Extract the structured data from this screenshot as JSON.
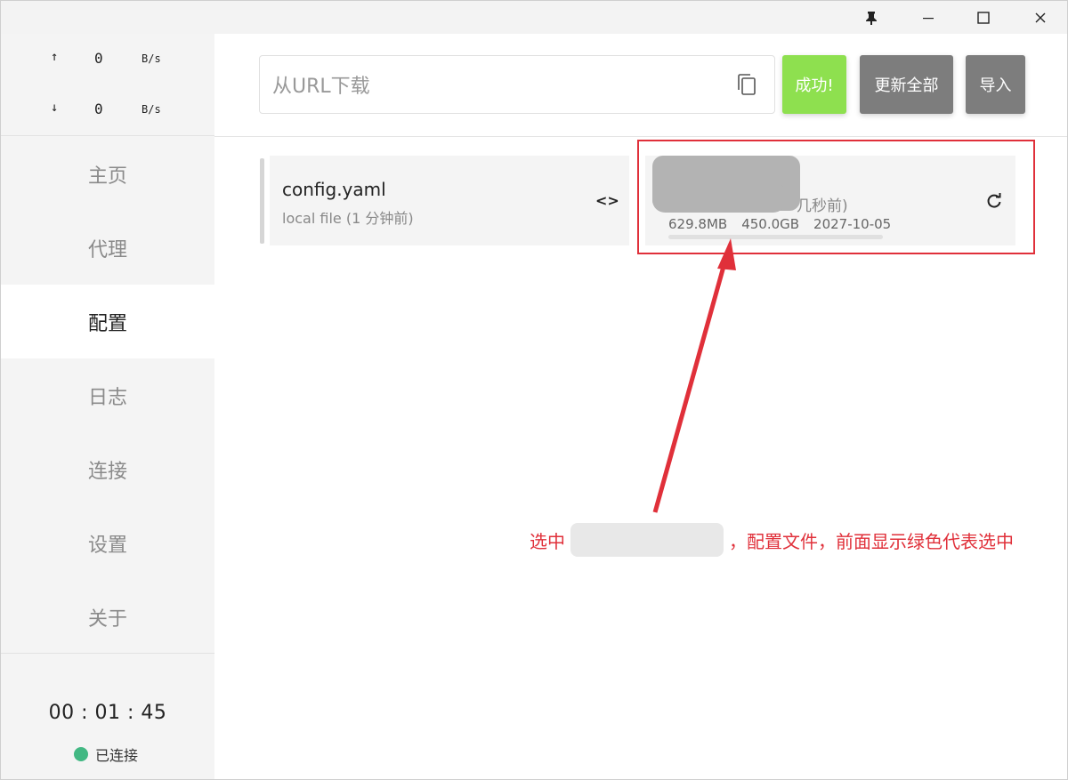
{
  "titlebar": {
    "pin_icon": "pin-icon",
    "minimize_icon": "minimize-icon",
    "maximize_icon": "maximize-icon",
    "close_icon": "close-icon"
  },
  "traffic": {
    "up_arrow": "↑",
    "up_value": "0",
    "up_unit": "B/s",
    "down_arrow": "↓",
    "down_value": "0",
    "down_unit": "B/s"
  },
  "nav": {
    "items": [
      {
        "label": "主页",
        "active": false
      },
      {
        "label": "代理",
        "active": false
      },
      {
        "label": "配置",
        "active": true
      },
      {
        "label": "日志",
        "active": false
      },
      {
        "label": "连接",
        "active": false
      },
      {
        "label": "设置",
        "active": false
      },
      {
        "label": "关于",
        "active": false
      }
    ]
  },
  "status": {
    "uptime": "00 : 01 : 45",
    "connection": "已连接",
    "connection_color": "#42b883"
  },
  "toolbar": {
    "url_placeholder": "从URL下载",
    "success_label": "成功!",
    "update_all_label": "更新全部",
    "import_label": "导入",
    "success_color": "#8ee04f",
    "button_color": "#7d7d7d"
  },
  "profiles": [
    {
      "name": "config.yaml",
      "subtitle": "local file (1 分钟前)",
      "selected": false
    },
    {
      "updated": "几秒前)",
      "used": "629.8MB",
      "total": "450.0GB",
      "expire": "2027-10-05",
      "selected": true,
      "selected_color": "#42b883"
    }
  ],
  "annotation": {
    "prefix": "选中",
    "suffix": "，配置文件，前面显示绿色代表选中",
    "color": "#e0303a"
  }
}
